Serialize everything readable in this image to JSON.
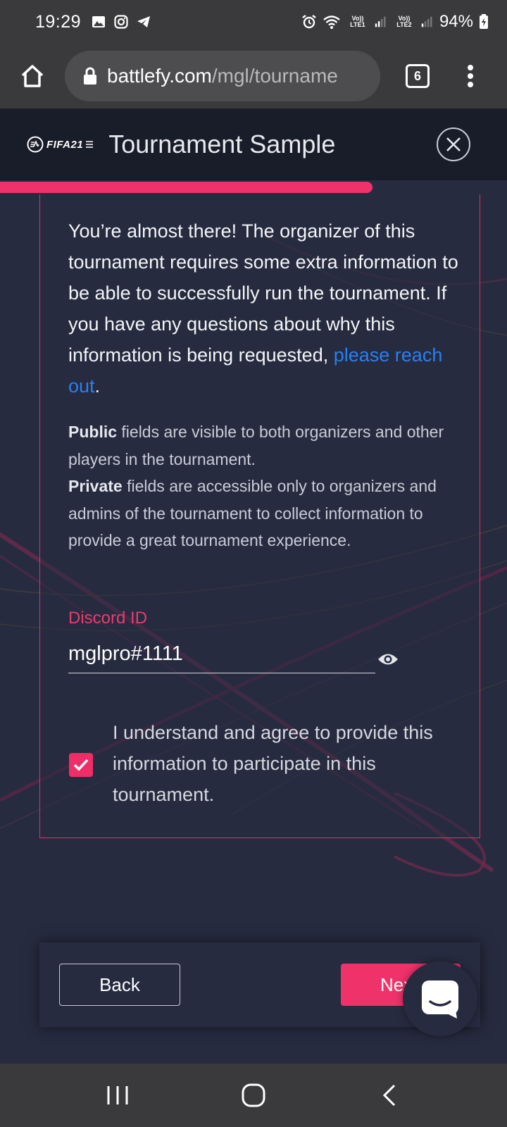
{
  "status_bar": {
    "time": "19:29",
    "lte1_label": "Vo)) LTE1",
    "lte2_label": "Vo)) LTE2",
    "battery": "94%"
  },
  "browser": {
    "url_domain": "battlefy.com",
    "url_path": "/mgl/tourname",
    "tab_count": "6"
  },
  "header": {
    "logo_text": "FIFA21",
    "title": "Tournament Sample",
    "progress_fraction": 0.735
  },
  "form": {
    "intro_text": "You’re almost there! The organizer of this tournament requires some extra information to be able to successfully run the tournament. If you have any questions about why this information is being requested, ",
    "intro_link": "please reach out",
    "intro_end": ".",
    "public_label": "Public",
    "public_text": " fields are visible to both organizers and other players in the tournament.",
    "private_label": "Private",
    "private_text": " fields are accessible only to organizers and admins of the tournament to collect information to provide a great tournament experience.",
    "discord_label": "Discord ID",
    "discord_value": "mglpro#1111",
    "agree_text": "I understand and agree to provide this information to participate in this tournament.",
    "agree_checked": true
  },
  "actions": {
    "back_label": "Back",
    "next_label": "Next"
  },
  "colors": {
    "accent": "#f0326b",
    "background": "#262b3f",
    "link": "#2b7ff0"
  }
}
